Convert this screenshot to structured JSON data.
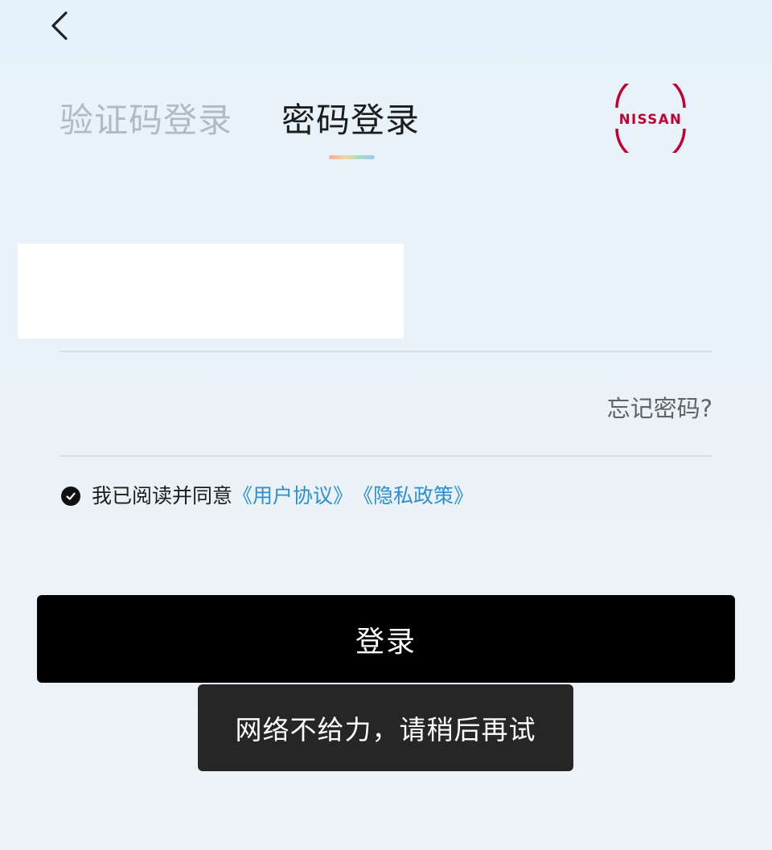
{
  "header": {
    "back_icon": "chevron-left-icon"
  },
  "tabs": [
    {
      "label": "验证码登录",
      "active": false
    },
    {
      "label": "密码登录",
      "active": true
    }
  ],
  "brand": {
    "logo_text": "NISSAN",
    "color": "#c3002f"
  },
  "form": {
    "password_placeholder": "",
    "forgot_label": "忘记密码?"
  },
  "agreement": {
    "checked": true,
    "text": "我已阅读并同意",
    "user_agreement": "《用户协议》",
    "privacy_policy": "《隐私政策》"
  },
  "login_button": {
    "label": "登录"
  },
  "toast": {
    "message": "网络不给力，请稍后再试"
  },
  "colors": {
    "link": "#2d8fd1",
    "button": "#000000",
    "toast_bg": "#262626",
    "inactive_tab": "#b3b9bf"
  }
}
